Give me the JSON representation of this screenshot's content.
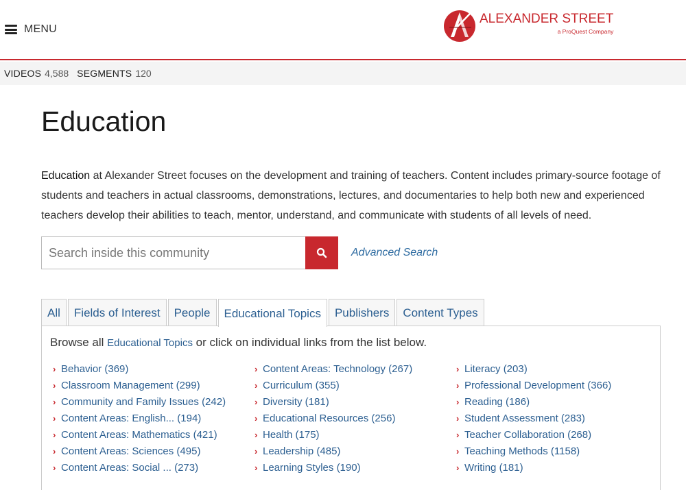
{
  "header": {
    "menu_label": "MENU",
    "logo_name": "ALEXANDER STREET",
    "logo_sub": "a ProQuest Company",
    "brand_color": "#c8282e"
  },
  "stats": {
    "videos_label": "VIDEOS",
    "videos_count": "4,588",
    "segments_label": "SEGMENTS",
    "segments_count": "120"
  },
  "page": {
    "title": "Education",
    "desc_lead": "Education",
    "desc_rest": " at Alexander Street focuses on the development and training of teachers. Content includes primary-source footage of students and teachers in actual classrooms, demonstrations, lectures, and documentaries to help both new and experienced teachers develop their abilities to teach, mentor, understand, and communicate with students of all levels of need."
  },
  "search": {
    "placeholder": "Search inside this community",
    "button_icon": "search-icon",
    "advanced_label": "Advanced Search"
  },
  "tabs": [
    {
      "label": "All",
      "active": false
    },
    {
      "label": "Fields of Interest",
      "active": false
    },
    {
      "label": "People",
      "active": false
    },
    {
      "label": "Educational Topics",
      "active": true
    },
    {
      "label": "Publishers",
      "active": false
    },
    {
      "label": "Content Types",
      "active": false
    }
  ],
  "panel": {
    "browse_prefix": "Browse all ",
    "browse_link": "Educational Topics",
    "browse_suffix": " or click on individual links from the list below.",
    "columns": [
      [
        "Behavior (369)",
        "Classroom Management (299)",
        "Community and Family Issues (242)",
        "Content Areas: English... (194)",
        "Content Areas: Mathematics (421)",
        "Content Areas: Sciences (495)",
        "Content Areas: Social ... (273)"
      ],
      [
        "Content Areas: Technology (267)",
        "Curriculum (355)",
        "Diversity (181)",
        "Educational Resources (256)",
        "Health (175)",
        "Leadership (485)",
        "Learning Styles (190)"
      ],
      [
        "Literacy (203)",
        "Professional Development (366)",
        "Reading (186)",
        "Student Assessment (283)",
        "Teacher Collaboration (268)",
        "Teaching Methods (1158)",
        "Writing (181)"
      ]
    ]
  }
}
